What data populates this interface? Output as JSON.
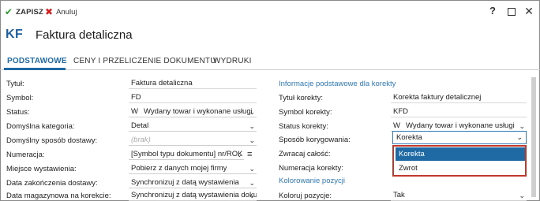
{
  "toolbar": {
    "save_label": "ZAPISZ",
    "cancel_label": "Anuluj",
    "help": "?",
    "close": "✕"
  },
  "header": {
    "badge": "KF",
    "title": "Faktura detaliczna"
  },
  "tabs": [
    {
      "label": "PODSTAWOWE"
    },
    {
      "label": "CENY I PRZELICZENIE DOKUMENTU"
    },
    {
      "label": "WYDRUKI"
    }
  ],
  "left": {
    "tytul": {
      "label": "Tytuł:",
      "value": "Faktura detaliczna"
    },
    "symbol": {
      "label": "Symbol:",
      "value": "FD"
    },
    "status": {
      "label": "Status:",
      "code": "W",
      "value": "Wydany towar i wykonane usługi"
    },
    "kategoria": {
      "label": "Domyślna kategoria:",
      "value": "Detal"
    },
    "dostawa": {
      "label": "Domyślny sposób dostawy:",
      "placeholder": "(brak)"
    },
    "numeracja": {
      "label": "Numeracja:",
      "value": "[Symbol typu dokumentu] nr/ROK"
    },
    "miejsce": {
      "label": "Miejsce wystawienia:",
      "value": "Pobierz z danych mojej firmy"
    },
    "zakonczenie": {
      "label": "Data zakończenia dostawy:",
      "value": "Synchronizuj z datą wystawienia"
    },
    "magazynowa": {
      "label": "Data magazynowa na korekcie:",
      "value": "Synchronizuj z datą wystawienia dokumentu"
    }
  },
  "right": {
    "section1": "Informacje podstawowe dla korekty",
    "tytul": {
      "label": "Tytuł korekty:",
      "value": "Korekta faktury detalicznej"
    },
    "symbol": {
      "label": "Symbol korekty:",
      "value": "KFD"
    },
    "status": {
      "label": "Status korekty:",
      "code": "W",
      "value": "Wydany towar i wykonane usługi"
    },
    "sposob": {
      "label": "Sposób korygowania:",
      "value": "Korekta",
      "options": [
        "Korekta",
        "Zwrot"
      ]
    },
    "zwracaj": {
      "label": "Zwracaj całość:"
    },
    "numeracja": {
      "label": "Numeracja korekty:"
    },
    "section2": "Kolorowanie pozycji",
    "koloruj": {
      "label": "Koloruj pozycje:",
      "value": "Tak"
    }
  },
  "colors": {
    "accent": "#1f6aa5",
    "link": "#2e79b8",
    "save": "#2e9c2e",
    "cancel": "#d42020",
    "highlight_border": "#c0392b"
  }
}
